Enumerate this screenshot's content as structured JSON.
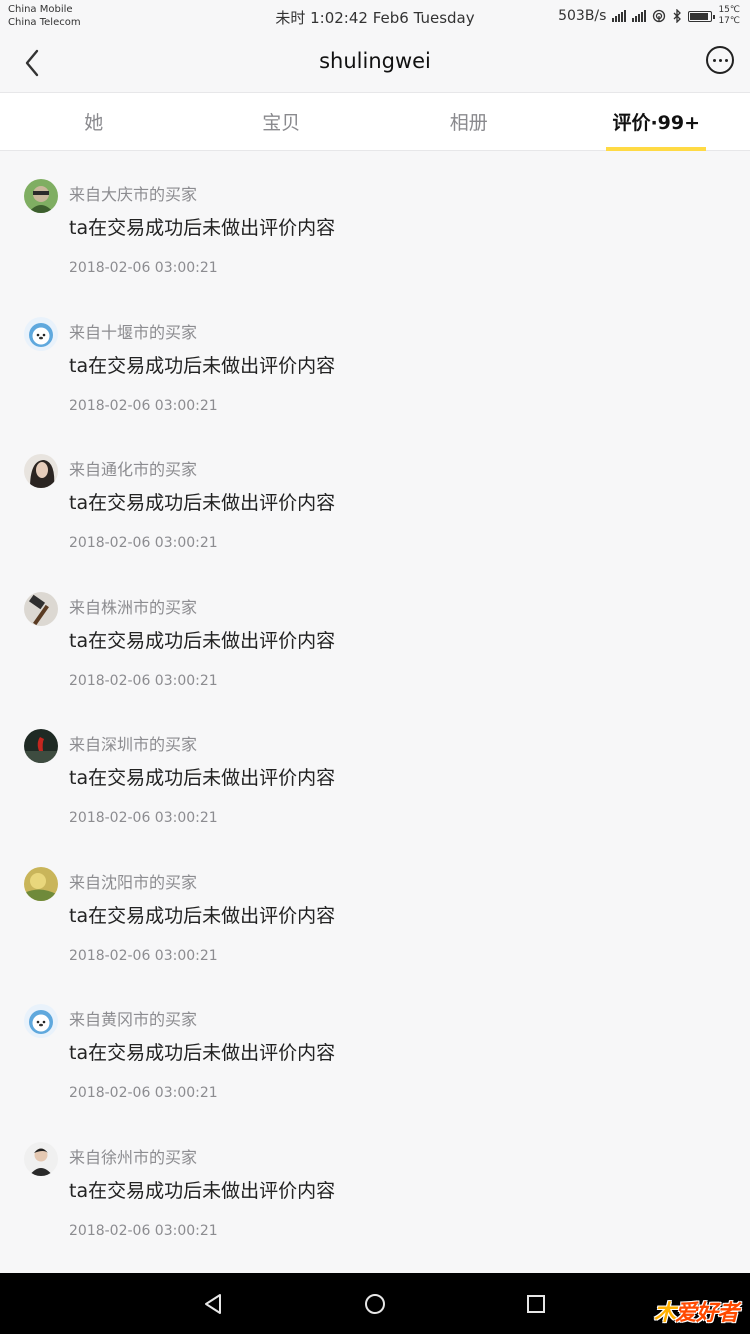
{
  "status_bar": {
    "carrier_1": "China Mobile",
    "carrier_2": "China Telecom",
    "time": "未时 1:02:42 Feb6 Tuesday",
    "net_speed": "503B/s",
    "temp_1": "15℃",
    "temp_2": "17℃"
  },
  "nav": {
    "title": "shulingwei"
  },
  "tabs": [
    {
      "label": "她",
      "active": false
    },
    {
      "label": "宝贝",
      "active": false
    },
    {
      "label": "相册",
      "active": false
    },
    {
      "label": "评价·99+",
      "active": true
    }
  ],
  "reviews": [
    {
      "from": "来自大庆市的买家",
      "text": "ta在交易成功后未做出评价内容",
      "date": "2018-02-06 03:00:21",
      "avatar": "green-hood-avatar"
    },
    {
      "from": "来自十堰市的买家",
      "text": "ta在交易成功后未做出评价内容",
      "date": "2018-02-06 03:00:21",
      "avatar": "cartoon-seal-avatar"
    },
    {
      "from": "来自通化市的买家",
      "text": "ta在交易成功后未做出评价内容",
      "date": "2018-02-06 03:00:21",
      "avatar": "portrait-avatar"
    },
    {
      "from": "来自株洲市的买家",
      "text": "ta在交易成功后未做出评价内容",
      "date": "2018-02-06 03:00:21",
      "avatar": "hammer-avatar"
    },
    {
      "from": "来自深圳市的买家",
      "text": "ta在交易成功后未做出评价内容",
      "date": "2018-02-06 03:00:21",
      "avatar": "red-figure-avatar"
    },
    {
      "from": "来自沈阳市的买家",
      "text": "ta在交易成功后未做出评价内容",
      "date": "2018-02-06 03:00:21",
      "avatar": "yellow-flower-avatar"
    },
    {
      "from": "来自黄冈市的买家",
      "text": "ta在交易成功后未做出评价内容",
      "date": "2018-02-06 03:00:21",
      "avatar": "cartoon-seal-avatar"
    },
    {
      "from": "来自徐州市的买家",
      "text": "ta在交易成功后未做出评价内容",
      "date": "2018-02-06 03:00:21",
      "avatar": "person-avatar"
    }
  ],
  "watermark": {
    "prefix": "木",
    "text": "爱好者"
  },
  "colors": {
    "accent": "#ffda44",
    "muted_text": "#8c8c90",
    "background": "#f7f7f8"
  }
}
